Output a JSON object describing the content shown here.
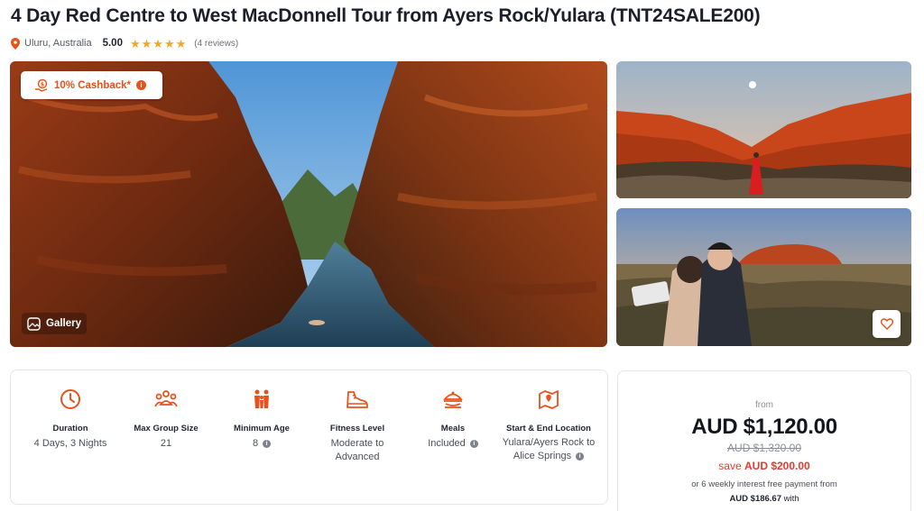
{
  "tour": {
    "title": "4 Day Red Centre to West MacDonnell Tour from Ayers Rock/Yulara (TNT24SALE200)",
    "location": "Uluru, Australia",
    "rating": "5.00",
    "stars": 5,
    "reviews": "(4 reviews)"
  },
  "gallery": {
    "cashback_label": "10% Cashback*",
    "gallery_label": "Gallery"
  },
  "features": [
    {
      "label": "Duration",
      "value": "4 Days, 3 Nights",
      "icon": "clock-icon"
    },
    {
      "label": "Max Group Size",
      "value": "21",
      "icon": "group-icon"
    },
    {
      "label": "Minimum Age",
      "value": "8",
      "icon": "people-icon",
      "info": true
    },
    {
      "label": "Fitness Level",
      "value": "Moderate to Advanced",
      "icon": "shoe-icon"
    },
    {
      "label": "Meals",
      "value": "Included",
      "icon": "meal-icon",
      "info": true
    },
    {
      "label": "Start & End Location",
      "value": "Yulara/Ayers Rock to Alice Springs",
      "icon": "map-pin-icon",
      "info": true
    }
  ],
  "pricing": {
    "from_label": "from",
    "price": "AUD $1,120.00",
    "original": "AUD $1,320.00",
    "save_prefix": "save",
    "save_amount": "AUD $200.00",
    "installment_text": "or 6 weekly interest free payment from",
    "installment_amount": "AUD $186.67",
    "installment_suffix": "with"
  },
  "colors": {
    "accent": "#e8521a",
    "star": "#f5a623",
    "save": "#e23b2e"
  }
}
